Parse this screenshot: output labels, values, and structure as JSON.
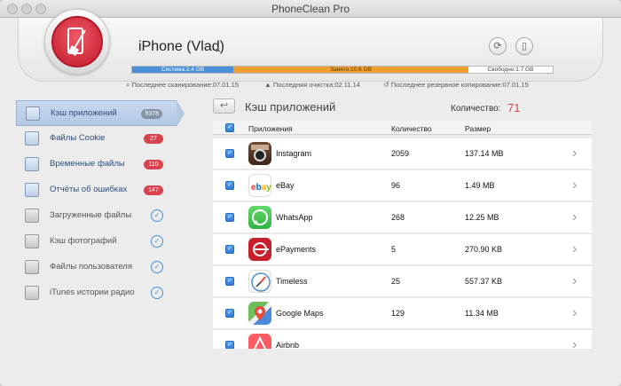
{
  "window": {
    "title": "PhoneClean Pro"
  },
  "device": {
    "name": "iPhone (Vlad)",
    "storage": {
      "system_label": "Система:2.4 GB",
      "system_fraction": 0.24,
      "used_label": "Занято:10.6 GB",
      "used_fraction": 0.56,
      "free_label": "Свободно:1.7 GB",
      "free_fraction": 0.2
    },
    "last_scan": "Последнее сканирование:07.01.15",
    "last_clean": "Последняя очистка:02.11.14",
    "last_backup": "Последнее резервное копирование:07.01.15"
  },
  "sidebar": {
    "items": [
      {
        "label": "Кэш приложений",
        "badge": "9378",
        "active": true
      },
      {
        "label": "Файлы Cookie",
        "badge": "27"
      },
      {
        "label": "Временные файлы",
        "badge": "110"
      },
      {
        "label": "Отчёты об ошибках",
        "badge": "147"
      },
      {
        "label": "Загруженные файлы",
        "check": "✓"
      },
      {
        "label": "Кэш фотографий",
        "check": "✓"
      },
      {
        "label": "Файлы пользователя",
        "check": "✓"
      },
      {
        "label": "iTunes истории радио",
        "check": "✓"
      }
    ]
  },
  "content": {
    "title": "Кэш приложений",
    "count_label": "Количество:",
    "count_value": "71",
    "columns": {
      "app": "Приложения",
      "count": "Количество",
      "size": "Размер"
    },
    "rows": [
      {
        "name": "Instagram",
        "count": "2059",
        "size": "137.14 MB",
        "icon": "instagram-icon"
      },
      {
        "name": "eBay",
        "count": "96",
        "size": "1.49 MB",
        "icon": "ebay-icon"
      },
      {
        "name": "WhatsApp",
        "count": "268",
        "size": "12.25 MB",
        "icon": "whatsapp-icon"
      },
      {
        "name": "ePayments",
        "count": "5",
        "size": "270.90 KB",
        "icon": "epayments-icon"
      },
      {
        "name": "Timeless",
        "count": "25",
        "size": "557.37 KB",
        "icon": "timeless-icon"
      },
      {
        "name": "Google Maps",
        "count": "129",
        "size": "11.34 MB",
        "icon": "google-maps-icon"
      },
      {
        "name": "Airbnb",
        "count": "",
        "size": "",
        "icon": "airbnb-icon"
      }
    ]
  },
  "colors": {
    "accent": "#d8434e",
    "selection": "#b3c7e2",
    "checkbox": "#2f7dd4",
    "system_bar": "#4a90d9",
    "used_bar": "#f0a030"
  }
}
